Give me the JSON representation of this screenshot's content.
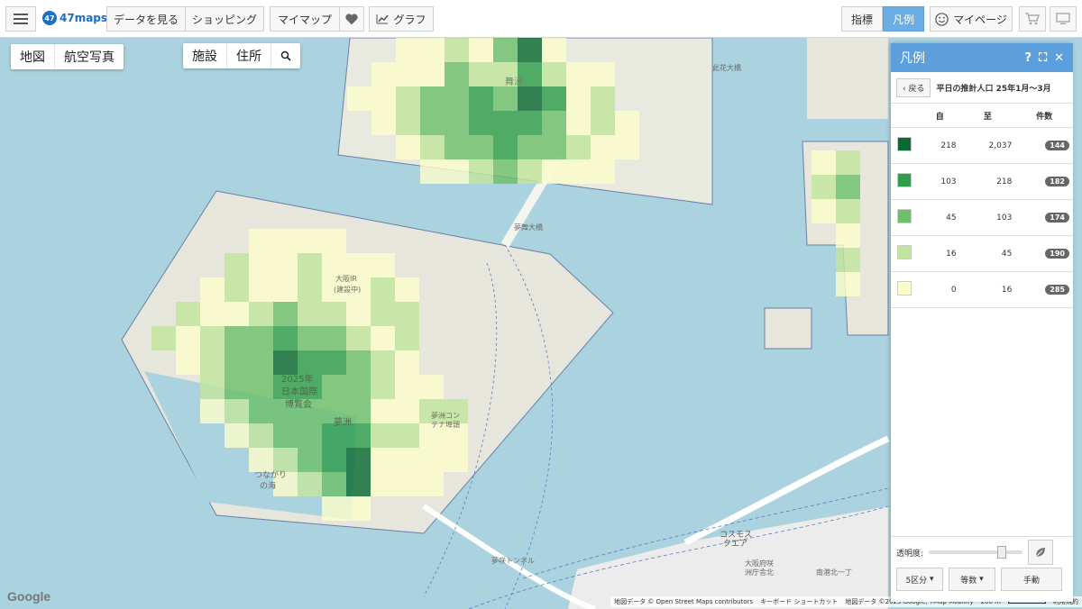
{
  "topbar": {
    "logo_text": "47maps",
    "logo_badge": "47",
    "logo_tm": "TM",
    "data_button": "データを見る",
    "shopping_button": "ショッピング",
    "mymap_button": "マイマップ",
    "graph_button": "グラフ",
    "indicator_button": "指標",
    "legend_button": "凡例",
    "mypage_button": "マイページ"
  },
  "map": {
    "view_map": "地図",
    "view_aerial": "航空写真",
    "facility": "施設",
    "address": "住所",
    "labels": {
      "expo_1": "2025年",
      "expo_2": "日本国際",
      "expo_3": "博覧会",
      "yumeshima": "夢洲",
      "tsunagari_1": "つながり",
      "tsunagari_2": "の海",
      "maishima": "舞洲",
      "yumemai_bridge": "夢舞大橋",
      "osaka_ir": "大阪IR",
      "under_construction": "(建設中)",
      "container_terminal_1": "夢洲コン",
      "container_terminal_2": "テナ埠頭",
      "yumeshima_tunnel": "夢咲トンネル",
      "cosmo_square_1": "コスモス",
      "cosmo_square_2": "クエア",
      "osaka_pref_1": "大阪府咲",
      "osaka_pref_2": "洲庁舎北",
      "nankou_kita": "南港北一丁",
      "kitahana_bridge": "此花大橋"
    },
    "google": "Google",
    "attribution": {
      "data": "地図データ © Open Street Maps contributors",
      "shortcut": "キーボード ショートカット",
      "google_data": "地図データ ©2025 Google, TMap Mobility",
      "scale": "200 m",
      "terms": "利用規約"
    }
  },
  "legend": {
    "title": "凡例",
    "back": "戻る",
    "subtitle": "平日の推計人口 25年1月〜3月",
    "col_from": "自",
    "col_to": "至",
    "col_count": "件数",
    "rows": [
      {
        "color": "#0b6a32",
        "from": "218",
        "to": "2,037",
        "count": "144"
      },
      {
        "color": "#2e9e4d",
        "from": "103",
        "to": "218",
        "count": "182"
      },
      {
        "color": "#6cc06b",
        "from": "45",
        "to": "103",
        "count": "174"
      },
      {
        "color": "#c2e59e",
        "from": "16",
        "to": "45",
        "count": "190"
      },
      {
        "color": "#fbfdcb",
        "from": "0",
        "to": "16",
        "count": "285"
      }
    ],
    "opacity_label": "透明度:",
    "classes": "5区分",
    "method": "等数",
    "manual": "手動"
  },
  "icons": {
    "menu": "menu-icon",
    "heart": "heart-icon",
    "chart": "chart-icon",
    "smile": "smile-icon",
    "cart": "cart-icon",
    "monitor": "monitor-icon",
    "search": "search-icon",
    "help": "help-icon",
    "fullscreen": "fullscreen-icon",
    "close": "close-icon",
    "leaf": "leaf-icon"
  }
}
